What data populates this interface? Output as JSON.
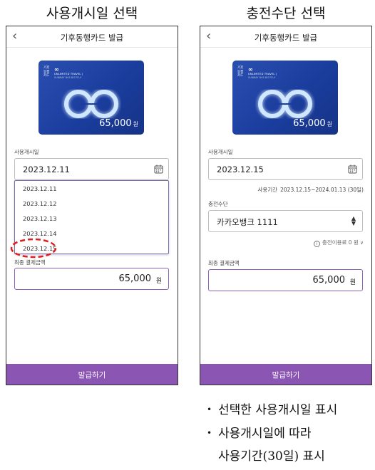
{
  "left_panel": {
    "heading": "사용개시일 선택",
    "title": "기후동행카드 발급",
    "card": {
      "brand": "기후 동행 카드",
      "logo": "∞",
      "tagline1": "UNLIMITED TRAVEL |",
      "tagline2": "SUBWAY BUS BICYCLE",
      "price": "65,000",
      "won": "원"
    },
    "start_date_label": "사용개시일",
    "start_date_value": "2023.12.11",
    "dropdown_options": [
      "2023.12.11",
      "2023.12.12",
      "2023.12.13",
      "2023.12.14",
      "2023.12.15"
    ],
    "total_label": "최종 결제금액",
    "total_amount": "65,000",
    "total_won": "원",
    "issue_button": "발급하기"
  },
  "right_panel": {
    "heading": "충전수단 선택",
    "title": "기후동행카드 발급",
    "card": {
      "brand": "기후 동행 카드",
      "logo": "∞",
      "tagline1": "UNLIMITED TRAVEL |",
      "tagline2": "SUBWAY BUS BICYCLE",
      "price": "65,000",
      "won": "원"
    },
    "start_date_label": "사용개시일",
    "start_date_value": "2023.12.15",
    "period_label": "사용기간",
    "period_value": "2023.12.15~2024.01.13 (30일)",
    "payment_label": "충전수단",
    "payment_value": "카카오뱅크 1111",
    "fee_text": "충전이용료 0 원",
    "total_label": "최종 결제금액",
    "total_amount": "65,000",
    "total_won": "원",
    "issue_button": "발급하기"
  },
  "bullets": [
    "선택한 사용개시일 표시",
    "사용개시일에 따라",
    "사용기간(30일) 표시"
  ],
  "colors": {
    "accent_purple": "#8b55b3",
    "card_blue": "#1f43a6",
    "highlight_red": "#e01e1e"
  },
  "icons": [
    "back-chevron-icon",
    "calendar-icon",
    "select-arrows-icon",
    "info-icon",
    "chevron-down-icon",
    "infinity-logo-icon"
  ]
}
